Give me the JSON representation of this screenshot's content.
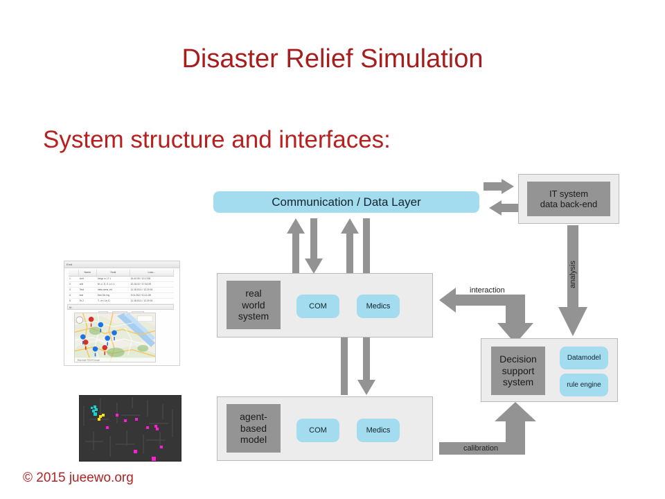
{
  "slide": {
    "title": "Disaster Relief Simulation",
    "subtitle": "System structure and interfaces:",
    "copyright": "© 2015 jueewo.org"
  },
  "colors": {
    "title_red": "#a71d1d",
    "accent_blue": "#a3dcef",
    "panel_gray": "#ececec",
    "dark_gray": "#949494",
    "arrow_gray": "#939393"
  },
  "diagram": {
    "communication_layer": {
      "label": "Communication / Data Layer"
    },
    "it_system": {
      "label_line1": "IT system",
      "label_line2": "data back-end"
    },
    "real_world_system": {
      "label_line1": "real",
      "label_line2": "world",
      "label_line3": "system",
      "modules": [
        {
          "label": "COM"
        },
        {
          "label": "Medics"
        }
      ]
    },
    "agent_based_model": {
      "label_line1": "agent-",
      "label_line2": "based",
      "label_line3": "model",
      "modules": [
        {
          "label": "COM"
        },
        {
          "label": "Medics"
        }
      ]
    },
    "decision_support_system": {
      "label_line1": "Decision",
      "label_line2": "support",
      "label_line3": "system",
      "modules": [
        {
          "label": "Datamodel"
        },
        {
          "label": "rule engine"
        }
      ]
    },
    "arrow_labels": {
      "interaction": "interaction",
      "analysis": "analysis",
      "calibration": "calibration"
    }
  },
  "thumbnails": {
    "app_window": {
      "title": "Emd",
      "columns": [
        "",
        "Name",
        "Scall",
        "Loss..."
      ],
      "rows": [
        [
          "1",
          "Unit",
          "Unigi..e./ 2 1",
          "16.42.50 / 13.1748"
        ],
        [
          "2",
          "unit",
          "M..i.l..E, 0..n 1 1",
          "20.18.02 / 17.04.05"
        ],
        [
          "3",
          "Test",
          "infoc,sens.,txt",
          "11.18.03.1 / 12.20.91"
        ],
        [
          "4",
          "test",
          "Devi tin.ing",
          "9.01.202 / 10.11.08"
        ],
        [
          "5",
          "Te.2",
          "T.. m i 1e-C",
          "11.18.03.1 / 12.20.91"
        ],
        [
          "6",
          "test",
          "sti",
          "12.18.02.0 / 12.21.06"
        ]
      ],
      "buttons": [
        "add",
        "unigtewn",
        "L save"
      ],
      "map_panel_title": "M..",
      "map_attribution": "Map data ©2014 Google"
    },
    "simulation_view": {
      "description": "agent-based simulation map view",
      "agent_colors": [
        "#16d2d2",
        "#ffe800",
        "#ff1cd6"
      ]
    }
  }
}
